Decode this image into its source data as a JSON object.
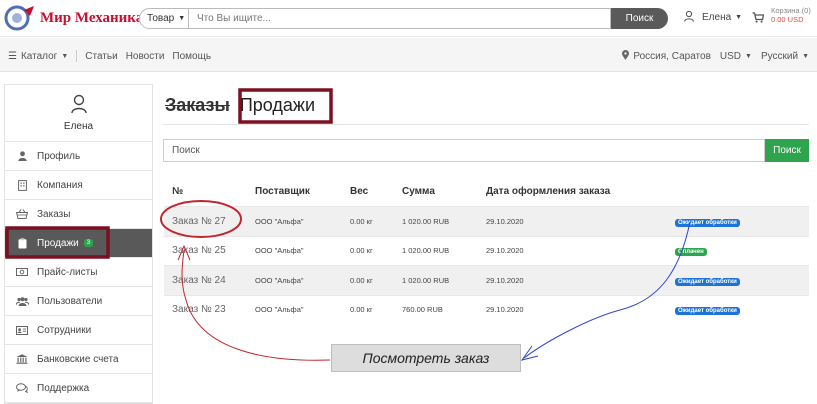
{
  "header": {
    "logo_text": "Мир Механика",
    "search_scope": "Товар",
    "search_placeholder": "Что Вы ищите...",
    "search_button": "Поиск",
    "user_name": "Елена",
    "cart_label": "Корзина (0)",
    "cart_total": "0.00 USD"
  },
  "subnav": {
    "catalog": "Каталог",
    "links": [
      "Статьи",
      "Новости",
      "Помощь"
    ],
    "location": "Россия, Саратов",
    "currency": "USD",
    "language": "Русский"
  },
  "sidebar": {
    "user_name": "Елена",
    "items": [
      {
        "label": "Профиль",
        "icon": "person-icon"
      },
      {
        "label": "Компания",
        "icon": "building-icon"
      },
      {
        "label": "Заказы",
        "icon": "basket-icon"
      },
      {
        "label": "Продажи",
        "icon": "clipboard-icon",
        "badge": "3"
      },
      {
        "label": "Прайс-листы",
        "icon": "money-icon"
      },
      {
        "label": "Пользователи",
        "icon": "users-icon"
      },
      {
        "label": "Сотрудники",
        "icon": "id-card-icon"
      },
      {
        "label": "Банковские счета",
        "icon": "bank-icon"
      },
      {
        "label": "Поддержка",
        "icon": "chat-icon"
      }
    ]
  },
  "main": {
    "tab_orders": "Заказы",
    "tab_sales": "Продажи",
    "search_placeholder": "Поиск",
    "search_button": "Поиск",
    "columns": [
      "№",
      "Поставщик",
      "Вес",
      "Сумма",
      "Дата оформления заказа"
    ],
    "rows": [
      {
        "number": "Заказ № 27",
        "supplier": "ООО \"Альфа\"",
        "weight": "0.00 кг",
        "sum": "1 020.00 RUB",
        "date": "29.10.2020",
        "status": "Ожидает обработки",
        "status_color": "#1e73d6"
      },
      {
        "number": "Заказ № 25",
        "supplier": "ООО \"Альфа\"",
        "weight": "0.00 кг",
        "sum": "1 020.00 RUB",
        "date": "29.10.2020",
        "status": "Оплачен",
        "status_color": "#2ea44f"
      },
      {
        "number": "Заказ № 24",
        "supplier": "ООО \"Альфа\"",
        "weight": "0.00 кг",
        "sum": "1 020.00 RUB",
        "date": "29.10.2020",
        "status": "Ожидает обработки",
        "status_color": "#1e73d6"
      },
      {
        "number": "Заказ № 23",
        "supplier": "ООО \"Альфа\"",
        "weight": "0.00 кг",
        "sum": "760.00 RUB",
        "date": "29.10.2020",
        "status": "Ожидает обработки",
        "status_color": "#1e73d6"
      }
    ]
  },
  "annotation": {
    "callout_text": "Посмотреть заказ",
    "highlight_color": "#7a1020",
    "circle_color": "#c0262d",
    "arrow_blue": "#2f45c8"
  }
}
